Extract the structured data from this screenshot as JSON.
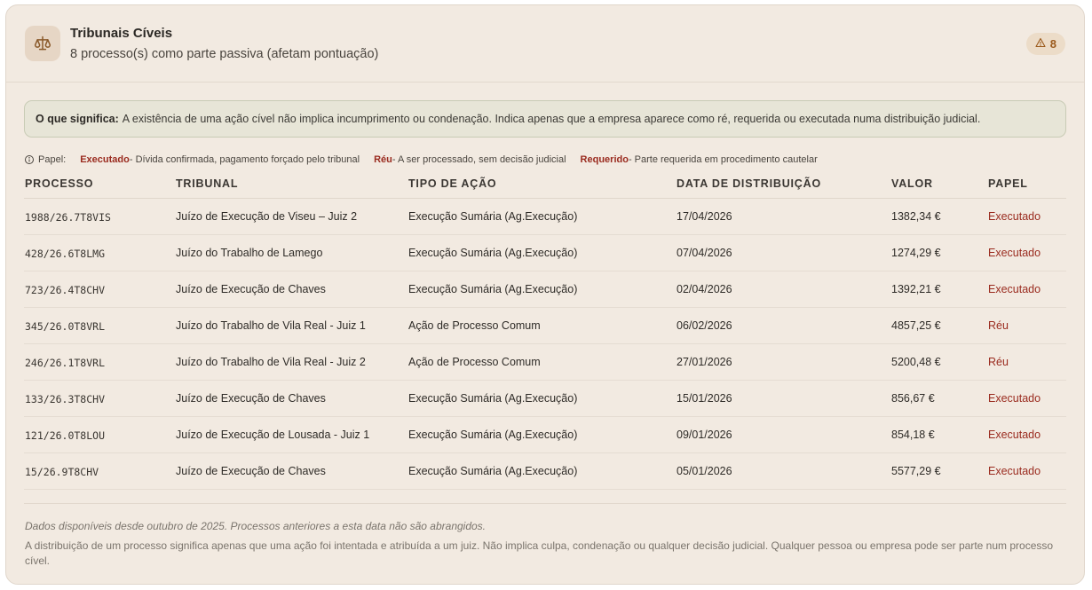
{
  "header": {
    "icon": "scales-icon",
    "title": "Tribunais Cíveis",
    "subtitle": "8 processo(s) como parte passiva (afetam pontuação)",
    "badge_icon": "warning-triangle-icon",
    "badge_count": "8"
  },
  "notice": {
    "label": "O que significa:",
    "text": "A existência de uma ação cível não implica incumprimento ou condenação. Indica apenas que a empresa aparece como ré, requerida ou executada numa distribuição judicial."
  },
  "legend": {
    "icon": "info-icon",
    "label": "Papel:",
    "items": [
      {
        "role": "Executado",
        "desc": " - Dívida confirmada, pagamento forçado pelo tribunal"
      },
      {
        "role": "Réu",
        "desc": " - A ser processado, sem decisão judicial"
      },
      {
        "role": "Requerido",
        "desc": " - Parte requerida em procedimento cautelar"
      }
    ]
  },
  "table": {
    "headers": [
      "PROCESSO",
      "TRIBUNAL",
      "TIPO DE AÇÃO",
      "DATA DE DISTRIBUIÇÃO",
      "VALOR",
      "PAPEL"
    ],
    "rows": [
      [
        "1988/26.7T8VIS",
        "Juízo de Execução de Viseu – Juiz 2",
        "Execução Sumária (Ag.Execução)",
        "17/04/2026",
        "1382,34 €",
        "Executado"
      ],
      [
        "428/26.6T8LMG",
        "Juízo do Trabalho de Lamego",
        "Execução Sumária (Ag.Execução)",
        "07/04/2026",
        "1274,29 €",
        "Executado"
      ],
      [
        "723/26.4T8CHV",
        "Juízo de Execução de Chaves",
        "Execução Sumária (Ag.Execução)",
        "02/04/2026",
        "1392,21 €",
        "Executado"
      ],
      [
        "345/26.0T8VRL",
        "Juízo do Trabalho de Vila Real - Juiz 1",
        "Ação de Processo Comum",
        "06/02/2026",
        "4857,25 €",
        "Réu"
      ],
      [
        "246/26.1T8VRL",
        "Juízo do Trabalho de Vila Real - Juiz 2",
        "Ação de Processo Comum",
        "27/01/2026",
        "5200,48 €",
        "Réu"
      ],
      [
        "133/26.3T8CHV",
        "Juízo de Execução de Chaves",
        "Execução Sumária (Ag.Execução)",
        "15/01/2026",
        "856,67 €",
        "Executado"
      ],
      [
        "121/26.0T8LOU",
        "Juízo de Execução de Lousada - Juiz 1",
        "Execução Sumária (Ag.Execução)",
        "09/01/2026",
        "854,18 €",
        "Executado"
      ],
      [
        "15/26.9T8CHV",
        "Juízo de Execução de Chaves",
        "Execução Sumária (Ag.Execução)",
        "05/01/2026",
        "5577,29 €",
        "Executado"
      ]
    ]
  },
  "footer": {
    "availability": "Dados disponíveis desde outubro de 2025. Processos anteriores a esta data não são abrangidos.",
    "disclaimer": "A distribuição de um processo significa apenas que uma ação foi intentada e atribuída a um juiz. Não implica culpa, condenação ou qualquer decisão judicial. Qualquer pessoa ou empresa pode ser parte num processo cível."
  },
  "colors": {
    "accent": "#9a2b1f",
    "card_bg": "#f2eae1",
    "badge_text": "#9b5a1c"
  }
}
